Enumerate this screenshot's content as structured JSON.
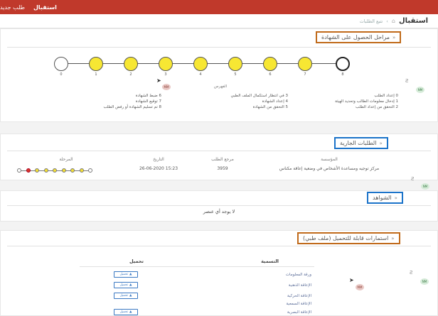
{
  "topbar": {
    "home": "استقبال",
    "new_request": "طلب جديد"
  },
  "subhead": {
    "title": "استقبال",
    "crumb": "تتبع الطلبات",
    "home_icon": "home-icon"
  },
  "sections": {
    "stages": "مراحل الحصول على الشهادة",
    "current": "الطلبات الجارية",
    "evidence": "الشواهد",
    "forms": "استمارات قابلة للتحميل (ملف طبي)"
  },
  "stepper": {
    "nodes": [
      {
        "num": "0",
        "state": "empty"
      },
      {
        "num": "1",
        "state": "done"
      },
      {
        "num": "2",
        "state": "done"
      },
      {
        "num": "3",
        "state": "done"
      },
      {
        "num": "4",
        "state": "done"
      },
      {
        "num": "5",
        "state": "done"
      },
      {
        "num": "6",
        "state": "done"
      },
      {
        "num": "7",
        "state": "done"
      },
      {
        "num": "8",
        "state": "last"
      }
    ]
  },
  "legend": {
    "title": "الفهرس",
    "col1": [
      "0 إعداد الطلب",
      "1 إدخال معلومات الطالب وتحديد الهيئة",
      "2 التحقق من إعداد الطلب"
    ],
    "col2": [
      "3 في انتظار استكمال الملف الطبي",
      "4 إعداد الشهادة",
      "5 التحقق من الشهادة"
    ],
    "col3": [
      "6 ضبط الشهادة",
      "7 توقيع الشهادة",
      "8 تم تسليم الشهادة أو رفض الطلب"
    ]
  },
  "badges": {
    "mr": "MR",
    "nm": "NM",
    "mm": "MM"
  },
  "current_table": {
    "headers": [
      "المؤسسة",
      "مرجع الطلب",
      "التاريخ",
      "المرحلة"
    ],
    "row": [
      "مركز توجيه ومساعدة الأشخاص في وضعية إعاقة مكناس",
      "3959",
      "15:23 26-06-2020",
      ""
    ],
    "progress": [
      "white",
      "red",
      "yellow",
      "yellow",
      "yellow",
      "yellow",
      "yellow",
      "yellow",
      "white"
    ]
  },
  "evidence": {
    "empty": "لا يوجد أي عنصر"
  },
  "forms": {
    "col_name": "التسمية",
    "col_download": "تحميل",
    "download_label": "تحميل",
    "rows": [
      "ورقة المعلومات",
      "الإعاقة الذهنية",
      "الإعاقة الحركية",
      "الإعاقة السمعية",
      "الإعاقة البصرية"
    ]
  }
}
